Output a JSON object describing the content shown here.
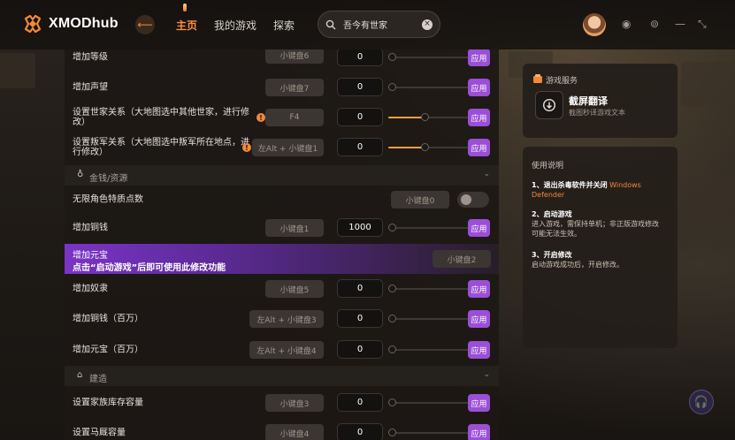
{
  "app": {
    "name": "XMODhub"
  },
  "nav": {
    "back_icon": "arrow-left",
    "items": [
      "主页",
      "我的游戏",
      "探索"
    ],
    "active": "主页"
  },
  "search": {
    "value": "吾今有世家"
  },
  "window_controls": [
    "settings-icon",
    "target-icon",
    "minimize-icon",
    "collapse-icon"
  ],
  "colors": {
    "accent": "#ff8a3c",
    "apply": "#9a4fd6",
    "banner": "#7a34c6"
  },
  "rows_top": [
    {
      "label": "增加等级",
      "hotkey": "小键盘6",
      "value": "0",
      "slider": 0.0,
      "apply": "应用"
    },
    {
      "label": "增加声望",
      "hotkey": "小键盘7",
      "value": "0",
      "slider": 0.0,
      "apply": "应用"
    },
    {
      "label": "设置世家关系（大地图选中其他世家，进行修改）",
      "warn": "!",
      "hotkey": "F4",
      "value": "0",
      "slider": 0.5,
      "apply": "应用"
    },
    {
      "label": "设置叛军关系（大地图选中叛军所在地点，进行修改）",
      "warn": "!",
      "hotkey": "左Alt + 小键盘1",
      "value": "0",
      "slider": 0.5,
      "apply": "应用"
    }
  ],
  "section_money": {
    "title": "金钱/资源",
    "icon": "money-bag-icon"
  },
  "row_attr": {
    "label": "无限角色特质点数",
    "hotkey": "小键盘0",
    "toggle": false
  },
  "row_bronze": {
    "label": "增加铜钱",
    "hotkey": "小键盘1",
    "value": "1000",
    "slider": 0.0,
    "apply": "应用"
  },
  "banner": {
    "label": "增加元宝",
    "message": "点击“启动游戏”后即可使用此修改功能",
    "hotkey": "小键盘2"
  },
  "rows_money": [
    {
      "label": "增加奴隶",
      "hotkey": "小键盘5",
      "value": "0",
      "slider": 0.0,
      "apply": "应用"
    },
    {
      "label": "增加铜钱（百万）",
      "hotkey": "左Alt + 小键盘3",
      "value": "0",
      "slider": 0.0,
      "apply": "应用"
    },
    {
      "label": "增加元宝（百万）",
      "hotkey": "左Alt + 小键盘4",
      "value": "0",
      "slider": 0.0,
      "apply": "应用"
    }
  ],
  "section_build": {
    "title": "建造",
    "icon": "building-icon"
  },
  "rows_build": [
    {
      "label": "设置家族库存容量",
      "hotkey": "小键盘3",
      "value": "0",
      "slider": 0.0,
      "apply": "应用"
    },
    {
      "label": "设置马厩容量",
      "hotkey": "小键盘4",
      "value": "0",
      "slider": 0.0,
      "apply": "应用"
    }
  ],
  "service": {
    "title": "游戏服务",
    "card_name": "截屏翻译",
    "card_desc": "截图秒译游戏文本"
  },
  "guide": {
    "title": "使用说明",
    "step1_title": "1、退出杀毒软件并关闭",
    "step1_highlight": "Windows Defender",
    "step2_title": "2、启动游戏",
    "step2_text": "进入游戏，需保持单机；非正版游戏修改可能无法生效。",
    "step3_title": "3、开启修改",
    "step3_text": "启动游戏成功后，开启修改。"
  }
}
